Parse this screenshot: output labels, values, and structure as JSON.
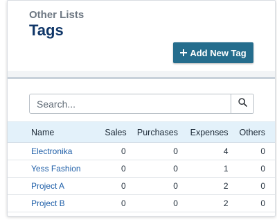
{
  "header": {
    "eyebrow": "Other Lists",
    "title": "Tags",
    "add_button": "Add New Tag",
    "add_icon": "plus-icon"
  },
  "search": {
    "placeholder": "Search...",
    "value": "",
    "icon": "search-icon"
  },
  "table": {
    "columns": [
      "Name",
      "Sales",
      "Purchases",
      "Expenses",
      "Others"
    ],
    "rows": [
      {
        "name": "Electronika",
        "sales": "0",
        "purchases": "0",
        "expenses": "4",
        "others": "0"
      },
      {
        "name": "Yess Fashion",
        "sales": "0",
        "purchases": "0",
        "expenses": "1",
        "others": "0"
      },
      {
        "name": "Project A",
        "sales": "0",
        "purchases": "0",
        "expenses": "2",
        "others": "0"
      },
      {
        "name": "Project B",
        "sales": "0",
        "purchases": "0",
        "expenses": "2",
        "others": "0"
      }
    ]
  },
  "colors": {
    "title": "#0f3668",
    "button": "#256d8d",
    "link": "#1f5fa8",
    "header_row": "#e3f1fa"
  }
}
